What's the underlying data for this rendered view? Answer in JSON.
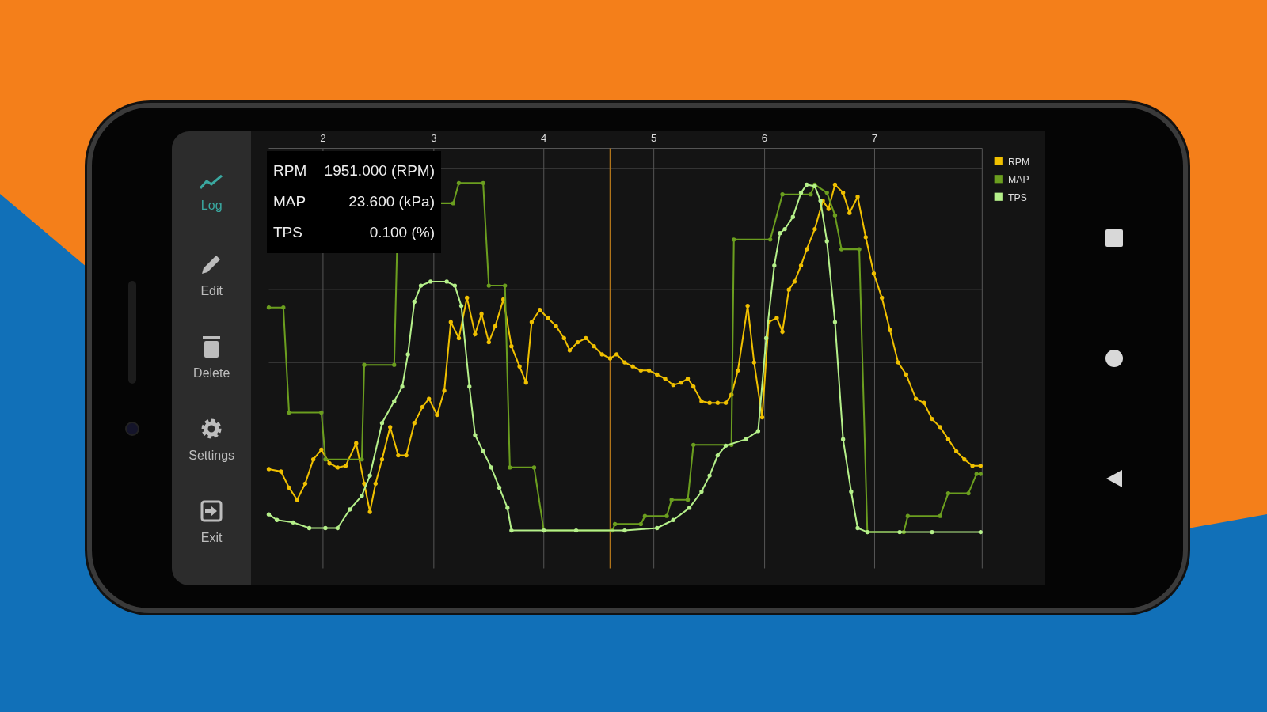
{
  "sidebar": {
    "items": [
      {
        "label": "Log",
        "selected": true
      },
      {
        "label": "Edit",
        "selected": false
      },
      {
        "label": "Delete",
        "selected": false
      },
      {
        "label": "Settings",
        "selected": false
      },
      {
        "label": "Exit",
        "selected": false
      }
    ]
  },
  "chart": {
    "x_tick_labels": [
      "2",
      "3",
      "4",
      "5",
      "6",
      "7"
    ],
    "legend": [
      {
        "label": "RPM",
        "color": "#f0c000"
      },
      {
        "label": "MAP",
        "color": "#6b9e1f"
      },
      {
        "label": "TPS",
        "color": "#b5f08a"
      }
    ],
    "tooltip": [
      {
        "label": "RPM",
        "value": "1951.000 (RPM)"
      },
      {
        "label": "MAP",
        "value": "23.600 (kPa)"
      },
      {
        "label": "TPS",
        "value": "0.100 (%)"
      }
    ]
  }
}
